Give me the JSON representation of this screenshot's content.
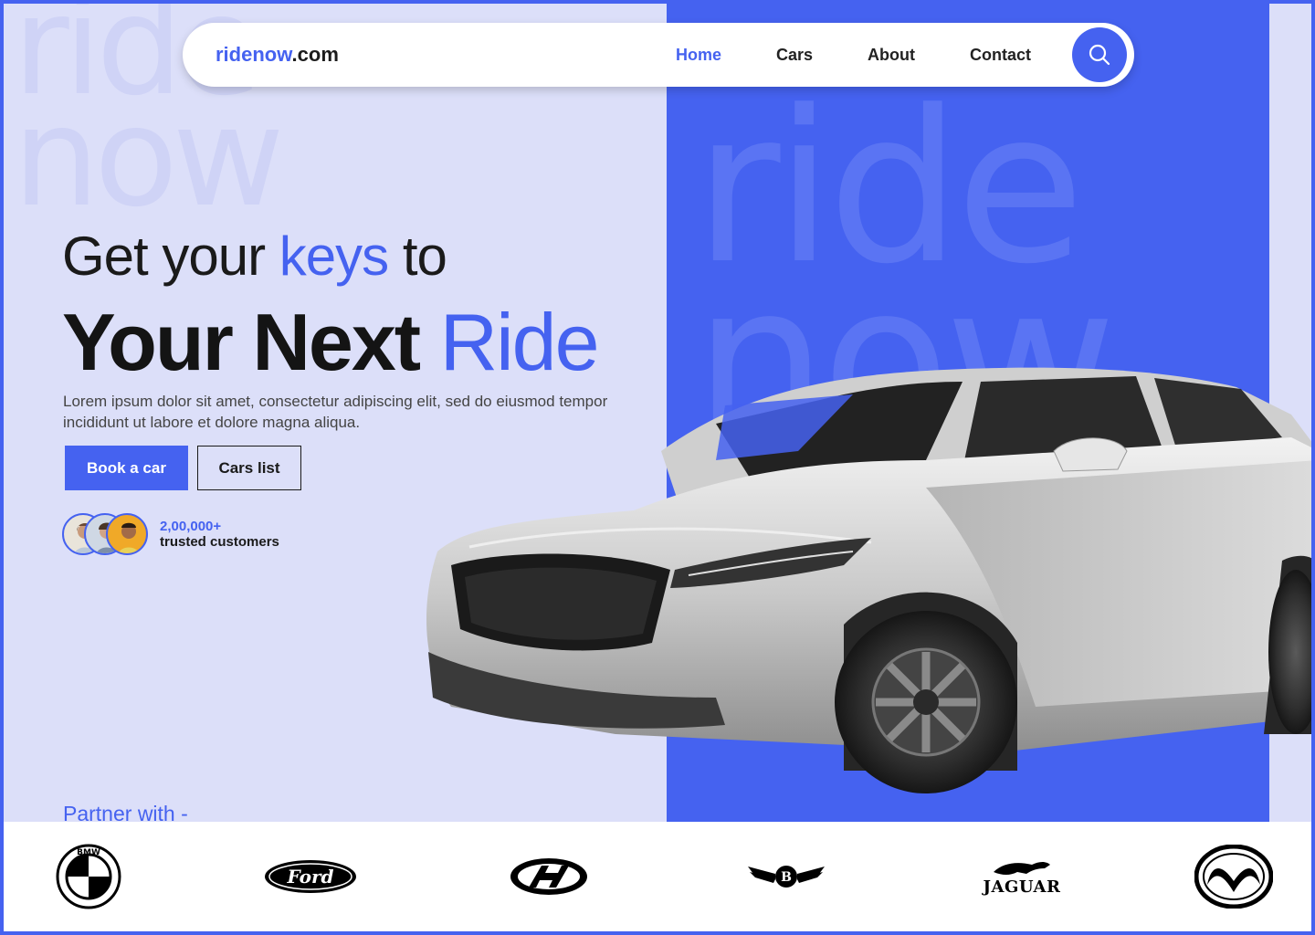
{
  "brand": {
    "name_main": "ridenow",
    "name_suffix": ".com"
  },
  "watermark": {
    "line1": "ride",
    "line2": "now"
  },
  "nav": {
    "items": [
      {
        "label": "Home",
        "active": true
      },
      {
        "label": "Cars",
        "active": false
      },
      {
        "label": "About",
        "active": false
      },
      {
        "label": "Contact",
        "active": false
      }
    ],
    "search_icon": "search-icon"
  },
  "hero": {
    "line1_a": "Get your ",
    "line1_accent": "keys",
    "line1_b": " to",
    "line2_a": "Your Next ",
    "line2_accent": "Ride",
    "description": "Lorem ipsum dolor sit amet, consectetur adipiscing elit, sed do eiusmod tempor incididunt ut labore et dolore magna aliqua."
  },
  "buttons": {
    "primary": "Book a car",
    "secondary": "Cars list"
  },
  "customers": {
    "count": "2,00,000+",
    "label": "trusted customers"
  },
  "partners": {
    "title": "Partner with -",
    "logos": [
      "bmw-logo",
      "ford-logo",
      "hyundai-logo",
      "bentley-logo",
      "jaguar-logo",
      "mazda-logo"
    ],
    "logo_text": {
      "ford": "Ford",
      "bentley": "B",
      "jaguar": "JAGUAR",
      "bmw": "BMW"
    }
  },
  "colors": {
    "accent": "#4562f0",
    "background": "#dcdff9",
    "text": "#1a1a1a"
  }
}
